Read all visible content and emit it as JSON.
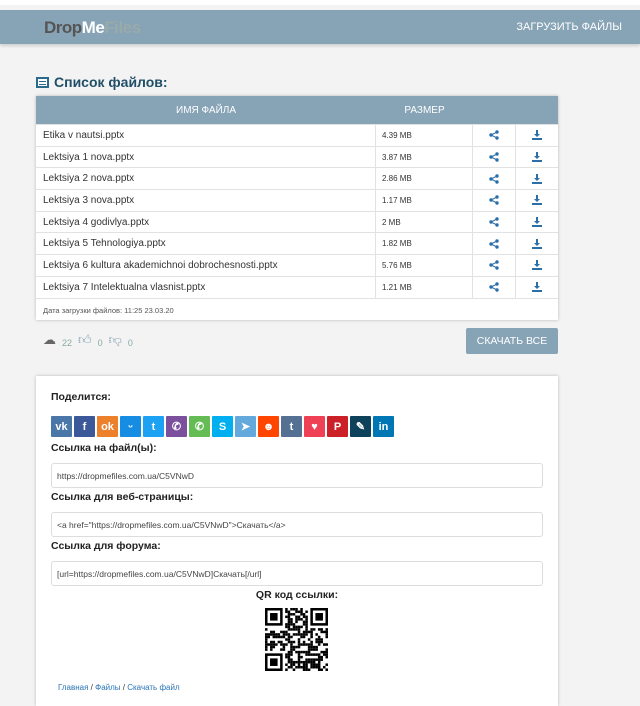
{
  "header": {
    "logo": [
      "Drop",
      "Me",
      "Files"
    ],
    "upload_label": "ЗАГРУЗИТЬ ФАЙЛЫ"
  },
  "file_list": {
    "title": "Список файлов:",
    "col_name": "ИМЯ ФАЙЛА",
    "col_size": "РАЗМЕР",
    "files": [
      {
        "name": "Etika v nautsi.pptx",
        "size": "4.39 MB"
      },
      {
        "name": "Lektsiya 1 nova.pptx",
        "size": "3.87 MB"
      },
      {
        "name": "Lektsiya 2 nova.pptx",
        "size": "2.86 MB"
      },
      {
        "name": "Lektsiya 3 nova.pptx",
        "size": "1.17 MB"
      },
      {
        "name": "Lektsiya 4 godivlya.pptx",
        "size": "2 MB"
      },
      {
        "name": "Lektsiya 5 Tehnologiya.pptx",
        "size": "1.82 MB"
      },
      {
        "name": "Lektsiya 6 kultura akademichnoi dobrochesnosti.pptx",
        "size": "5.76 MB"
      },
      {
        "name": "Lektsiya 7 Intelektualna vlasnist.pptx",
        "size": "1.21 MB"
      }
    ],
    "upload_date": "Дата загрузки файлов: 11:25 23.03.20"
  },
  "stats": {
    "downloads": "22",
    "likes": "0",
    "dislikes": "0"
  },
  "download_all_label": "СКАЧАТЬ ВСЕ",
  "share": {
    "title": "Поделится:",
    "networks": [
      {
        "name": "vk",
        "glyph": "vk",
        "color": "#4a76a8"
      },
      {
        "name": "facebook",
        "glyph": "f",
        "color": "#3b5998"
      },
      {
        "name": "odnoklassniki",
        "glyph": "ok",
        "color": "#ed812b"
      },
      {
        "name": "moimir",
        "glyph": "ᵕ",
        "color": "#168de2"
      },
      {
        "name": "twitter",
        "glyph": "t",
        "color": "#1da1f2"
      },
      {
        "name": "viber",
        "glyph": "✆",
        "color": "#7b519d"
      },
      {
        "name": "whatsapp",
        "glyph": "✆",
        "color": "#65bc54"
      },
      {
        "name": "skype",
        "glyph": "S",
        "color": "#00aff0"
      },
      {
        "name": "telegram",
        "glyph": "➤",
        "color": "#64a9dc"
      },
      {
        "name": "reddit",
        "glyph": "☻",
        "color": "#ff4500"
      },
      {
        "name": "tumblr",
        "glyph": "t",
        "color": "#547093"
      },
      {
        "name": "pocket",
        "glyph": "♥",
        "color": "#ef4056"
      },
      {
        "name": "pinterest",
        "glyph": "P",
        "color": "#cb2027"
      },
      {
        "name": "livejournal",
        "glyph": "✎",
        "color": "#0d425a"
      },
      {
        "name": "linkedin",
        "glyph": "in",
        "color": "#0077b5"
      }
    ],
    "file_link_label": "Ссылка на файл(ы):",
    "file_link": "https://dropmefiles.com.ua/C5VNwD",
    "web_link_label": "Ссылка для веб-страницы:",
    "web_link": "<a href=\"https://dropmefiles.com.ua/C5VNwD\">Скачать</a>",
    "forum_link_label": "Ссылка для форума:",
    "forum_link": "[url=https://dropmefiles.com.ua/C5VNwD]Скачать[/url]",
    "qr_label": "QR код ссылки:"
  },
  "breadcrumb": [
    "Главная",
    "Файлы",
    "Скачать файл"
  ]
}
